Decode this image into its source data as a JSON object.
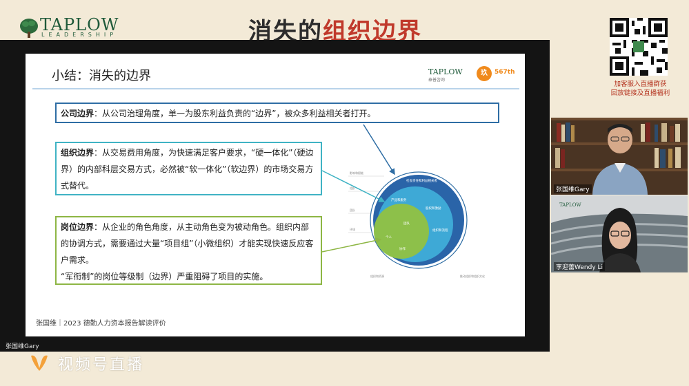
{
  "header": {
    "logo_name": "TAPLOW",
    "logo_sub": "LEADERSHIP",
    "title_part1": "消失的",
    "title_part2": "组织边界"
  },
  "qr": {
    "line1": "加客服入直播群获",
    "line2": "回放链接及直播福利"
  },
  "slide": {
    "title": "小结：消失的边界",
    "logo": "TAPLOW",
    "logo_sub": "泰普咨询",
    "badge": "567th",
    "box1": {
      "label": "公司边界",
      "text": "：从公司治理角度，单一为股东利益负责的“边界”，被众多利益相关者打开。"
    },
    "box2": {
      "label": "组织边界",
      "text": "：从交易费用角度，为快速满足客户要求，“硬一体化”（硬边界）的内部科层交易方式，必然被“软一体化”（软边界）的市场交易方式替代。"
    },
    "box3": {
      "label": "岗位边界",
      "text": "：从企业的角色角度，从主动角色变为被动角色。组织内部的协调方式，需要通过大量“项目组”（小微组织）才能实现快速反应客户需求。",
      "text2": "“军衔制”的岗位等级制（边界）严重阻碍了项目的实施。"
    },
    "footer": "张国维｜2023 德勤人力资本报告解读评价",
    "diagram": {
      "outer": [
        "社会责任和利益相关者"
      ],
      "middle": [
        "产品和服务",
        "股权和激励",
        "组织和流程"
      ],
      "inner": [
        "个人",
        "团队",
        "协作"
      ],
      "left_labels": [
        "影响和赋能",
        "组织",
        "团队",
        "环境"
      ],
      "bottom_labels": [
        "推动组织和组织文化",
        "组织和资源"
      ]
    }
  },
  "presenter_label": "张国维Gary",
  "watermark": "视频号直播",
  "participants": [
    {
      "name": "张国维Gary"
    },
    {
      "name": "李迎蕾Wendy Li"
    }
  ],
  "colors": {
    "title_red": "#c0392b",
    "brand_green": "#1f5a3a",
    "box1_border": "#2e6da4",
    "box2_border": "#3fb3c4",
    "box3_border": "#8db644"
  }
}
